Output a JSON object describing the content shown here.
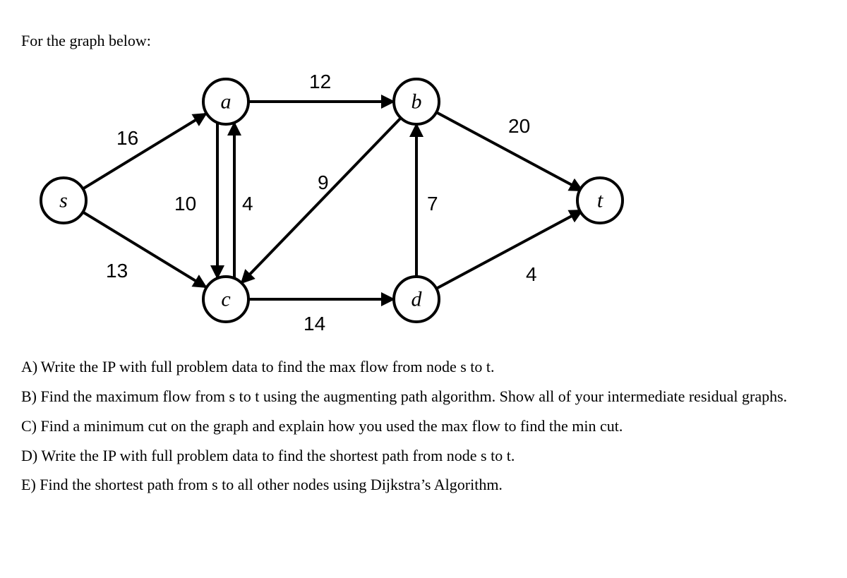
{
  "intro": "For the graph below:",
  "graph": {
    "nodes": {
      "s": "s",
      "a": "a",
      "b": "b",
      "c": "c",
      "d": "d",
      "t": "t"
    },
    "weights": {
      "sa": "16",
      "sc": "13",
      "ac": "10",
      "ca": "4",
      "ab": "12",
      "bc": "9",
      "cd": "14",
      "db": "7",
      "bt": "20",
      "dt": "4"
    }
  },
  "questions": {
    "a": "A) Write the IP with full problem data to find the max flow from node s to t.",
    "b": "B) Find the maximum flow from s to t using the augmenting path algorithm.  Show all of your intermediate residual graphs.",
    "c": "C) Find a minimum cut on the graph and explain how you used the max flow to find the min cut.",
    "d": "D) Write the IP with full problem data to find the shortest path from node s to t.",
    "e": "E) Find the shortest path from s to all other nodes using Dijkstra’s Algorithm."
  }
}
